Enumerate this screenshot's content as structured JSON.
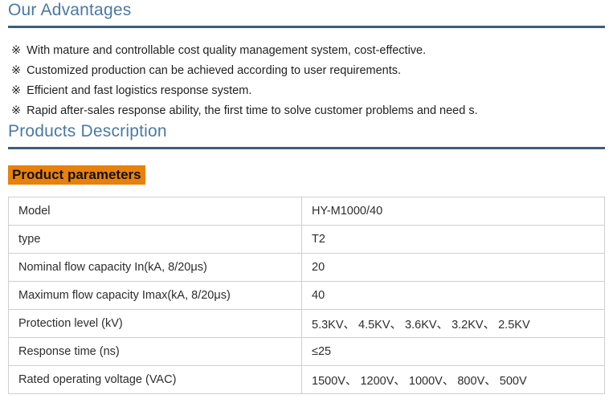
{
  "advantages": {
    "heading": "Our Advantages",
    "marker": "※",
    "items": [
      "With mature and controllable cost quality management system, cost-effective.",
      "Customized production can be achieved according to user requirements.",
      "Efficient and fast logistics response system.",
      "Rapid after-sales response ability, the first time to solve customer problems and need s."
    ]
  },
  "products_description": {
    "heading": "Products Description",
    "subheading": "Product parameters"
  },
  "parameters_table": {
    "rows": [
      {
        "label": "Model",
        "value": "HY-M1000/40"
      },
      {
        "label": "type",
        "value": "T2"
      },
      {
        "label": "Nominal flow capacity In(kA, 8/20μs)",
        "value": "20"
      },
      {
        "label": "Maximum flow capacity Imax(kA, 8/20μs)",
        "value": "40"
      },
      {
        "label": "Protection level (kV)",
        "value": "5.3KV、 4.5KV、 3.6KV、 3.2KV、 2.5KV"
      },
      {
        "label": "Response time (ns)",
        "value": "≤25"
      },
      {
        "label": "Rated operating voltage (VAC)",
        "value": "1500V、 1200V、 1000V、 800V、 500V"
      }
    ]
  },
  "colors": {
    "heading_text": "#4a79a3",
    "section_divider": "#3f5c7a",
    "subheading_highlight": "#e8810c",
    "table_border": "#cfcfcf"
  }
}
